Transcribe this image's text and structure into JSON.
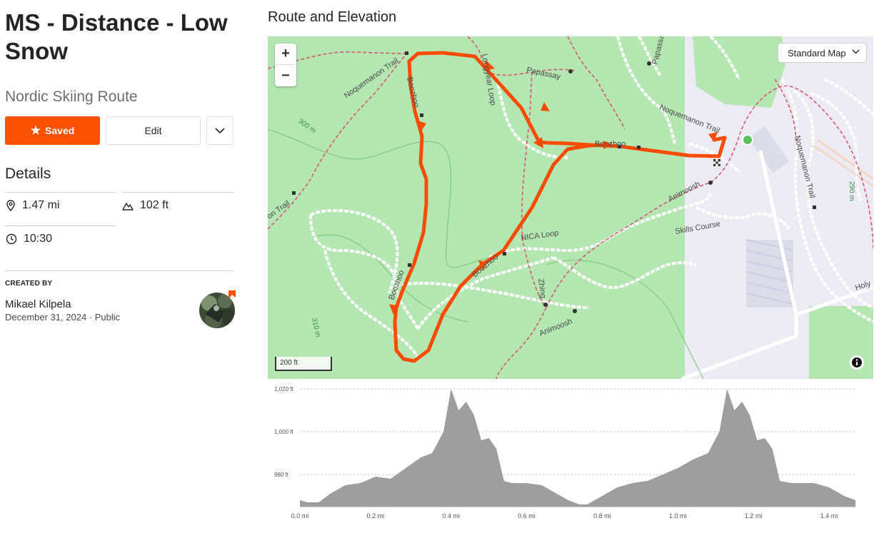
{
  "route": {
    "title": "MS - Distance - Low Snow",
    "type": "Nordic Skiing Route"
  },
  "actions": {
    "saved_label": "Saved",
    "edit_label": "Edit"
  },
  "details": {
    "heading": "Details",
    "distance": "1.47 mi",
    "elevation_gain": "102 ft",
    "time": "10:30"
  },
  "creator": {
    "label": "CREATED BY",
    "name": "Mikael Kilpela",
    "date": "December 31, 2024",
    "visibility": "Public"
  },
  "section": {
    "title": "Route and Elevation"
  },
  "map": {
    "style_select": "Standard Map",
    "scale_label": "200 ft",
    "zoom_in": "+",
    "zoom_out": "−",
    "labels": {
      "noquemanon_trail_nw": "Noquemanon Trail",
      "noquemanon_trail_e": "Noquemanon Trail",
      "noquemanon_trail_far_e": "Noquemanon Trail",
      "noquemanon_trail_w": "on Trail",
      "boozhoo_1": "Boozhoo",
      "boozhoo_2": "Boozhoo",
      "boozhoo_3": "Boozhoo",
      "boozhoo_4": "Boozhoo",
      "longyear_loop": "Longyear Loop",
      "papassay_1": "Papassay",
      "papassay_2": "Papassay",
      "nica_loop": "NICA Loop",
      "zhing": "Zhing",
      "animoosh_1": "Animoosh",
      "animoosh_2": "Animoosh",
      "skills_course": "Skills Course",
      "contour_300": "300 m",
      "contour_310": "310 m",
      "contour_290": "290 m",
      "holy": "Holy"
    }
  },
  "colors": {
    "accent": "#fc5200",
    "route": "#fc4c02",
    "start_marker": "#5cc25a",
    "park": "#b3e6b0",
    "elevation_fill": "#9e9e9e"
  },
  "chart_data": {
    "type": "area",
    "xlabel": "",
    "ylabel": "",
    "x_ticks": [
      "0.0 mi",
      "0.2 mi",
      "0.4 mi",
      "0.6 mi",
      "0.8 mi",
      "1.0 mi",
      "1.2 mi",
      "1.4 mi"
    ],
    "y_ticks": [
      "1,020 ft",
      "1,000 ft",
      "980 ft"
    ],
    "xlim": [
      0,
      1.47
    ],
    "ylim": [
      965,
      1020
    ],
    "grid": true,
    "series": [
      {
        "x": [
          0,
          0.02,
          0.05,
          0.08,
          0.12,
          0.16,
          0.2,
          0.24,
          0.28,
          0.32,
          0.35,
          0.38,
          0.4,
          0.42,
          0.44,
          0.46,
          0.48,
          0.5,
          0.52,
          0.54,
          0.56,
          0.58,
          0.6,
          0.64,
          0.68,
          0.71,
          0.74,
          0.76,
          0.8,
          0.84,
          0.88,
          0.92,
          0.96,
          1.0,
          1.04,
          1.08,
          1.11,
          1.13,
          1.15,
          1.17,
          1.19,
          1.21,
          1.23,
          1.25,
          1.27,
          1.3,
          1.33,
          1.36,
          1.4,
          1.44,
          1.47
        ],
        "y": [
          968,
          967,
          967,
          971,
          975,
          976,
          979,
          978,
          983,
          988,
          990,
          1000,
          1020,
          1010,
          1014,
          1008,
          996,
          997,
          992,
          977,
          976,
          976,
          976,
          975,
          971,
          968,
          966,
          966,
          970,
          974,
          976,
          977,
          980,
          983,
          987,
          990,
          1000,
          1020,
          1010,
          1014,
          1008,
          996,
          997,
          992,
          977,
          976,
          976,
          976,
          974,
          970,
          968
        ]
      }
    ]
  }
}
